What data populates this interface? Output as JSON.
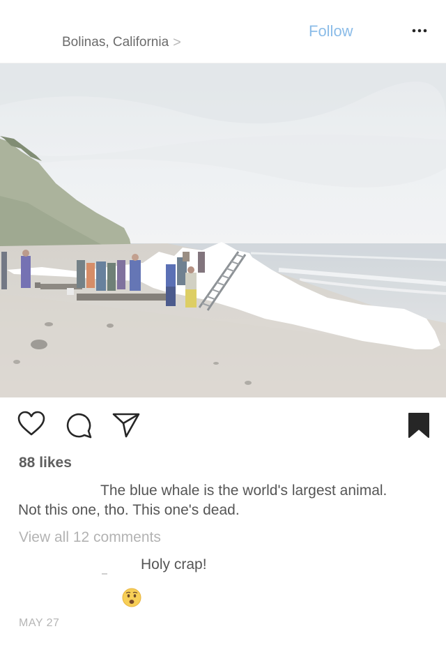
{
  "post": {
    "location": "Bolinas, California",
    "location_chevron": ">",
    "follow_label": "Follow",
    "more_label": "•••",
    "likes": "88 likes",
    "caption": "The blue whale is the world's largest animal. Not this one, tho. This one's dead.",
    "view_comments": "View all 12 comments",
    "comment": "Holy crap!",
    "date": "MAY 27"
  },
  "colors": {
    "follow": "#8bbce8",
    "text": "#555555",
    "muted": "#b3b3b3"
  },
  "icons": {
    "like": "heart-outline-icon",
    "comment": "speech-bubble-icon",
    "share": "paper-plane-icon",
    "save": "bookmark-filled-icon",
    "emoji": "anxious-face-emoji"
  }
}
